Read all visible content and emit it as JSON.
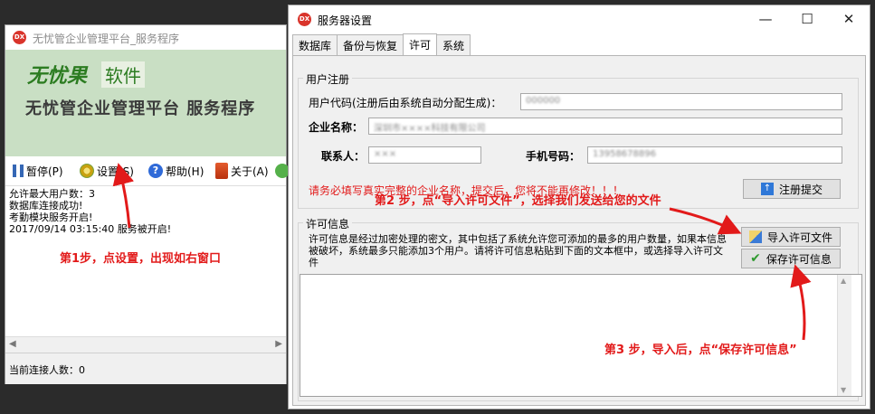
{
  "left_window": {
    "title": "无忧管企业管理平台_服务程序",
    "logo_text": "DX",
    "brand_name": "无忧果",
    "brand_tag": "软件",
    "subtitle": "无忧管企业管理平台 服务程序",
    "toolbar": {
      "pause": "暂停(P)",
      "settings": "设置(S)",
      "help": "帮助(H)",
      "about": "关于(A)"
    },
    "log_lines": [
      "允许最大用户数：3",
      "数据库连接成功!",
      "考勤模块服务开启!",
      "2017/09/14 03:15:40 服务被开启!"
    ],
    "status_text": "当前连接人数：0"
  },
  "right_window": {
    "title": "服务器设置",
    "logo_text": "DX",
    "window_controls": {
      "minimize": "—",
      "maximize": "☐",
      "close": "✕"
    },
    "tabs": [
      "数据库",
      "备份与恢复",
      "许可",
      "系统"
    ],
    "active_tab": "许可",
    "registration": {
      "group_label": "用户注册",
      "user_code_label": "用户代码(注册后由系统自动分配生成)：",
      "user_code_value": "000000",
      "company_label": "企业名称：",
      "company_value": "深圳市××××科技有限公司",
      "contact_label": "联系人：",
      "contact_value": "×××",
      "phone_label": "手机号码：",
      "phone_value": "13958678896",
      "warning": "请务必填写真实完整的企业名称，提交后，您将不能再修改！！！",
      "submit_label": "注册提交"
    },
    "license": {
      "group_label": "许可信息",
      "description": "许可信息是经过加密处理的密文，其中包括了系统允许您可添加的最多的用户数量，如果本信息被破坏，系统最多只能添加3个用户。请将许可信息粘贴到下面的文本框中，或选择导入许可文件",
      "import_label": "导入许可文件",
      "save_label": "保存许可信息",
      "text_value": ""
    }
  },
  "annotations": {
    "step1": "第1步，点设置，出现如右窗口",
    "step2": "第2 步，点“导入许可文件”，选择我们发送给您的文件",
    "step3": "第3 步，导入后，点“保存许可信息”"
  },
  "colors": {
    "annotation_red": "#e21a1a",
    "banner_green": "#c9dfc4",
    "brand_green": "#2c7c21"
  }
}
